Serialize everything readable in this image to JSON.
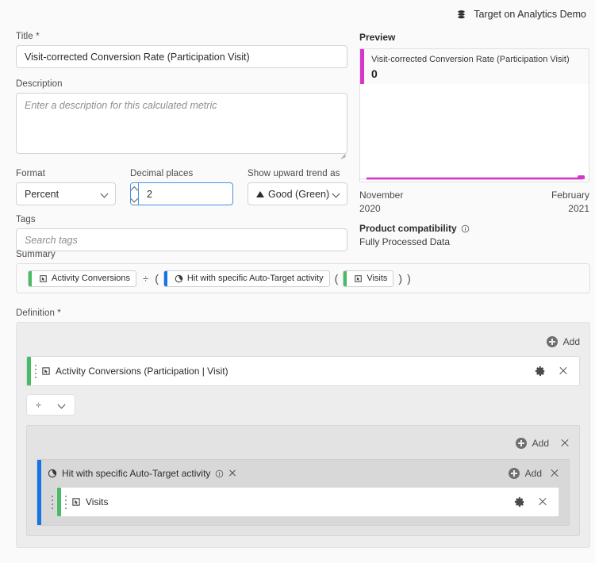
{
  "topbar": {
    "report_suite_icon": "data-layers-icon",
    "report_suite": "Target on Analytics Demo"
  },
  "form": {
    "title_label": "Title *",
    "title_value": "Visit-corrected Conversion Rate (Participation Visit)",
    "description_label": "Description",
    "description_value": "",
    "description_placeholder": "Enter a description for this calculated metric",
    "format_label": "Format",
    "format_value": "Percent",
    "decimal_label": "Decimal places",
    "decimal_value": "2",
    "trend_label": "Show upward trend as",
    "trend_value": "Good (Green)",
    "trend_icon": "triangle-up-icon",
    "tags_label": "Tags",
    "tags_value": "",
    "tags_placeholder": "Search tags"
  },
  "summary": {
    "label": "Summary",
    "tokens": [
      {
        "kind": "chip",
        "color": "green",
        "icon": "metric-icon",
        "label": "Activity Conversions"
      },
      {
        "kind": "operator",
        "label": "÷"
      },
      {
        "kind": "paren",
        "label": "("
      },
      {
        "kind": "chip",
        "color": "blue",
        "icon": "segment-icon",
        "label": "Hit with specific Auto-Target activity"
      },
      {
        "kind": "paren",
        "label": "("
      },
      {
        "kind": "chip",
        "color": "green",
        "icon": "metric-icon",
        "label": "Visits"
      },
      {
        "kind": "paren",
        "label": ")"
      },
      {
        "kind": "paren",
        "label": ")"
      }
    ]
  },
  "definition": {
    "label": "Definition *",
    "add_label": "Add",
    "row_1": {
      "icon": "metric-icon",
      "label": "Activity Conversions (Participation | Visit)",
      "gear_icon": "gear-icon",
      "close_icon": "close-icon",
      "accent_color": "#49bb67"
    },
    "operator": {
      "symbol": "÷",
      "chevron_icon": "chevron-down-icon"
    },
    "container": {
      "add_label": "Add",
      "close_icon": "close-icon",
      "accent_color": "#1473e6",
      "segment": {
        "icon": "segment-icon",
        "label": "Hit with specific Auto-Target activity",
        "info_icon": "info-icon",
        "close_icon": "close-icon",
        "add_label": "Add",
        "container_close_icon": "close-icon",
        "metric": {
          "icon": "metric-icon",
          "label": "Visits",
          "gear_icon": "gear-icon",
          "close_icon": "close-icon",
          "accent_color": "#49bb67"
        }
      }
    }
  },
  "preview": {
    "title": "Preview",
    "metric_name": "Visit-corrected Conversion Rate (Participation Visit)",
    "value": "0",
    "accent_color": "#d536c9",
    "start_month": "November",
    "start_year": "2020",
    "end_month": "February",
    "end_year": "2021",
    "compatibility_label": "Product compatibility",
    "compatibility_info_icon": "info-icon",
    "compatibility_value": "Fully Processed Data"
  },
  "chart_data": {
    "type": "line",
    "title": "Visit-corrected Conversion Rate (Participation Visit)",
    "xlabel": "",
    "ylabel": "",
    "x": [
      "November 2020",
      "February 2021"
    ],
    "series": [
      {
        "name": "Visit-corrected Conversion Rate (Participation Visit)",
        "values": [
          0,
          0,
          0,
          0,
          0,
          0,
          0,
          0,
          0,
          0,
          0,
          0
        ]
      }
    ],
    "ylim": [
      0,
      1
    ],
    "grid": false,
    "legend": "none",
    "line_color": "#d536c9",
    "marker_at_end": true
  }
}
